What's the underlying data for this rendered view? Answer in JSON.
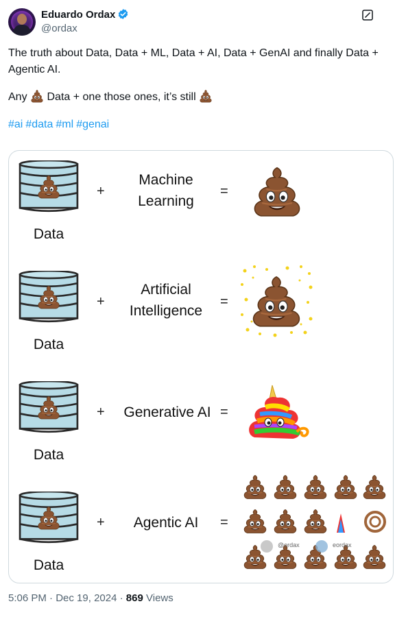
{
  "author": {
    "name": "Eduardo Ordax",
    "handle": "@ordax"
  },
  "post": {
    "line1": "The truth about Data, Data + ML, Data + AI, Data + GenAI and finally Data + Agentic AI.",
    "line2_a": "Any",
    "line2_b": "Data + one those ones, it’s still",
    "hashtags": [
      "#ai",
      "#data",
      "#ml",
      "#genai"
    ]
  },
  "card": {
    "rows": [
      {
        "data_label": "Data",
        "plus": "+",
        "term": "Machine Learning",
        "equals": "=",
        "result_icon": "poop-emoji"
      },
      {
        "data_label": "Data",
        "plus": "+",
        "term": "Artificial Intelligence",
        "equals": "=",
        "result_icon": "sparkly-poop"
      },
      {
        "data_label": "Data",
        "plus": "+",
        "term": "Generative AI",
        "equals": "=",
        "result_icon": "rainbow-unicorn-poop"
      },
      {
        "data_label": "Data",
        "plus": "+",
        "term": "Agentic AI",
        "equals": "=",
        "result_icon": "many-poops-grid"
      }
    ],
    "watermark_1": "@ordax",
    "watermark_2": "eordax"
  },
  "meta": {
    "time": "5:06 PM",
    "sep1": "·",
    "date": "Dec 19, 2024",
    "sep2": "·",
    "views_count": "869",
    "views_label": "Views"
  },
  "colors": {
    "link": "#1d9bf0",
    "muted": "#536471",
    "db_fill": "#a9d7e4",
    "poop": "#7a4a2a"
  }
}
